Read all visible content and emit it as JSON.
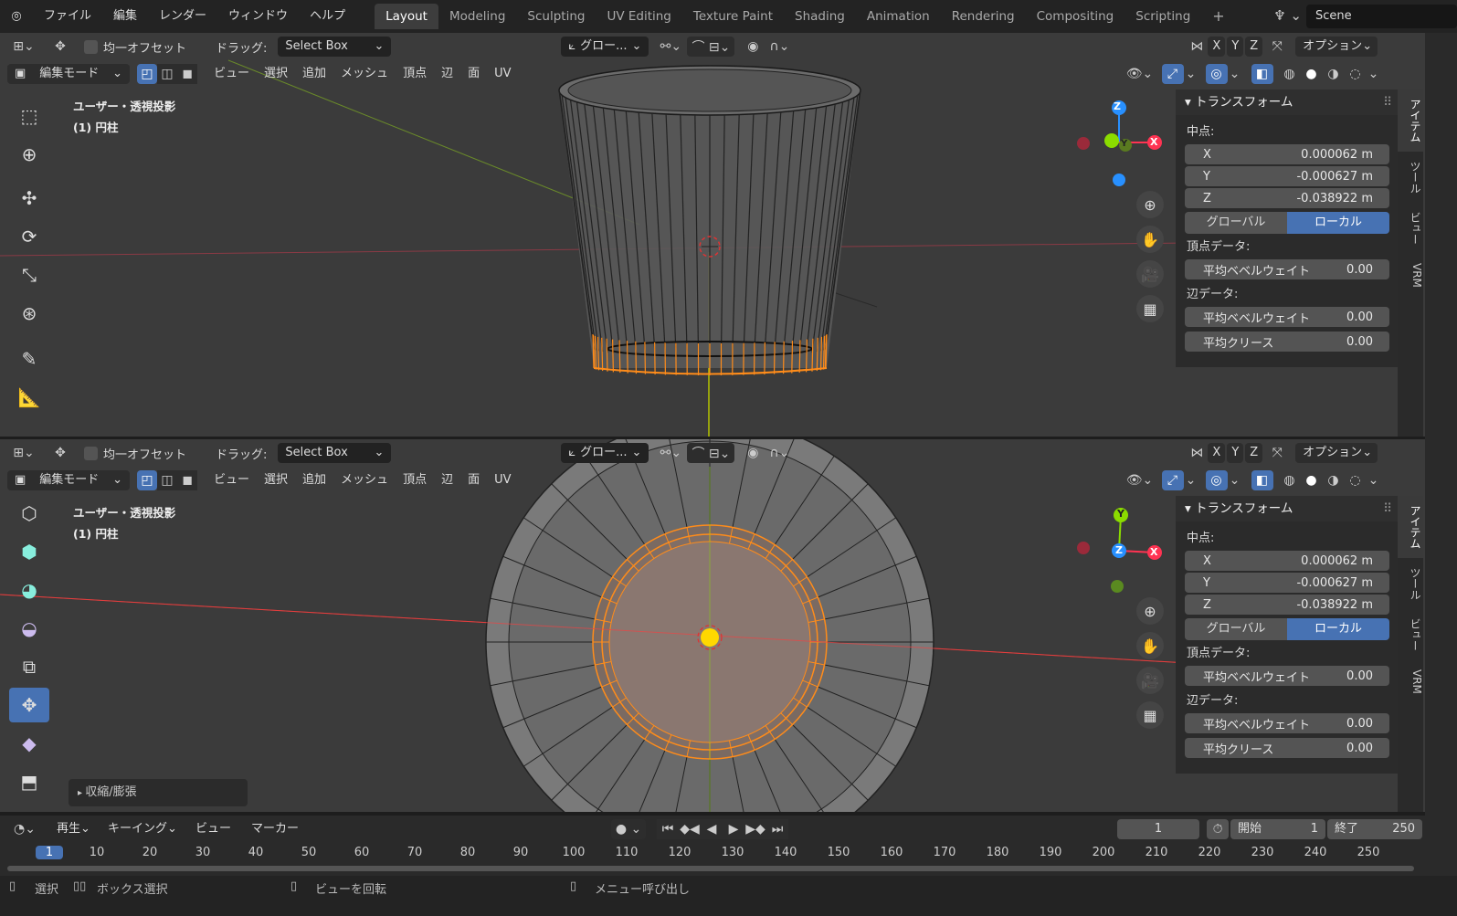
{
  "app": {
    "menus": [
      "ファイル",
      "編集",
      "レンダー",
      "ウィンドウ",
      "ヘルプ"
    ],
    "workspaces": [
      "Layout",
      "Modeling",
      "Sculpting",
      "UV Editing",
      "Texture Paint",
      "Shading",
      "Animation",
      "Rendering",
      "Compositing",
      "Scripting"
    ],
    "active_workspace": "Layout",
    "add_workspace": "+",
    "scene": "Scene"
  },
  "viewport_top": {
    "even_offset": "均一オフセット",
    "drag_label": "ドラッグ:",
    "drag_value": "Select Box",
    "orientation": "グロー...",
    "xyz": [
      "X",
      "Y",
      "Z"
    ],
    "options": "オプション",
    "mode": "編集モード",
    "header_menus": [
      "ビュー",
      "選択",
      "追加",
      "メッシュ",
      "頂点",
      "辺",
      "面",
      "UV"
    ],
    "view_name": "ユーザー・透視投影",
    "object_name": "(1) 円柱",
    "gizmo": {
      "z": "Z",
      "x": "X",
      "y": "Y"
    }
  },
  "viewport_bottom": {
    "even_offset": "均一オフセット",
    "drag_label": "ドラッグ:",
    "drag_value": "Select Box",
    "orientation": "グロー...",
    "xyz": [
      "X",
      "Y",
      "Z"
    ],
    "options": "オプション",
    "mode": "編集モード",
    "header_menus": [
      "ビュー",
      "選択",
      "追加",
      "メッシュ",
      "頂点",
      "辺",
      "面",
      "UV"
    ],
    "view_name": "ユーザー・透視投影",
    "object_name": "(1) 円柱",
    "operator_panel": "収縮/膨張",
    "gizmo": {
      "z": "Z",
      "x": "X",
      "y": "Y"
    }
  },
  "npanel": {
    "title": "トランスフォーム",
    "median": "中点:",
    "x_label": "X",
    "x_value": "0.000062 m",
    "y_label": "Y",
    "y_value": "-0.000627 m",
    "z_label": "Z",
    "z_value": "-0.038922 m",
    "global": "グローバル",
    "local": "ローカル",
    "vertex_data": "頂点データ:",
    "mean_bevel_weight": "平均ベベルウェイト",
    "vertex_bevel_value": "0.00",
    "edge_data": "辺データ:",
    "edge_bevel_value": "0.00",
    "mean_crease": "平均クリース",
    "crease_value": "0.00",
    "tabs": [
      "アイテム",
      "ツール",
      "ビュー",
      "VRM"
    ]
  },
  "timeline": {
    "playback": "再生",
    "keying": "キーイング",
    "view": "ビュー",
    "marker": "マーカー",
    "current_frame": "1",
    "start_label": "開始",
    "start": "1",
    "end_label": "終了",
    "end": "250",
    "ticks": [
      "1",
      "10",
      "20",
      "30",
      "40",
      "50",
      "60",
      "70",
      "80",
      "90",
      "100",
      "110",
      "120",
      "130",
      "140",
      "150",
      "160",
      "170",
      "180",
      "190",
      "200",
      "210",
      "220",
      "230",
      "240",
      "250"
    ]
  },
  "status": {
    "select": "選択",
    "box_select": "ボックス選択",
    "rotate_view": "ビューを回転",
    "call_menu": "メニュー呼び出し"
  },
  "colors": {
    "accent": "#4772b3",
    "selected": "#ff8c1a",
    "axis_x": "#ff3352",
    "axis_y": "#8bdc00",
    "axis_z": "#2890ff"
  }
}
